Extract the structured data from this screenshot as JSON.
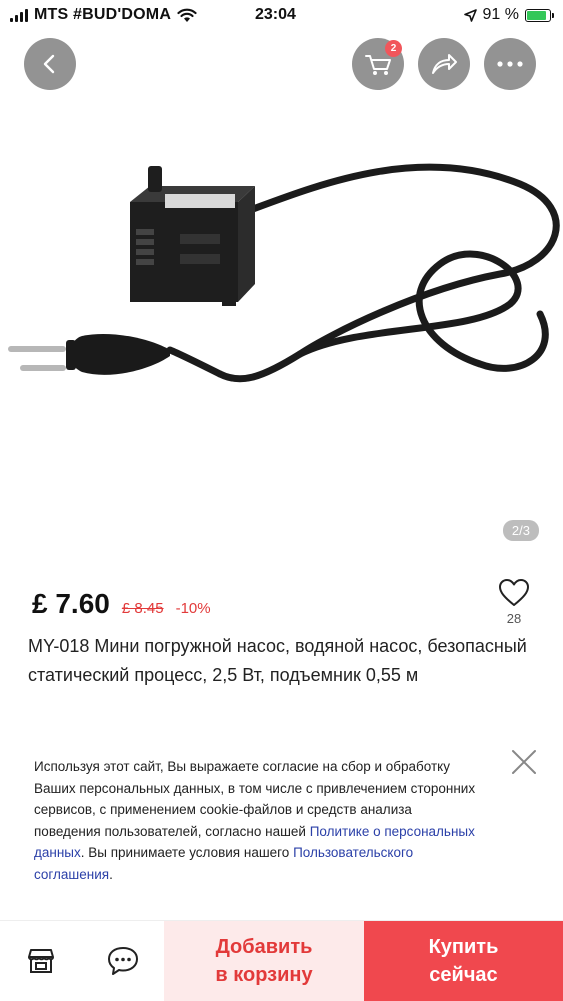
{
  "status_bar": {
    "carrier": "MTS #BUD'DOMA",
    "time": "23:04",
    "battery": "91 %",
    "battery_level": 0.91
  },
  "product": {
    "image_counter": "2/3",
    "cart_count": "2",
    "price": "£ 7.60",
    "old_price": "£ 8.45",
    "discount": "-10%",
    "wishlist_count": "28",
    "title": "MY-018 Мини погружной насос, водяной насос, безопасный статический процесс, 2,5 Вт, подъемник 0,55 м"
  },
  "cookie_notice": {
    "text_1": "Используя этот сайт, Вы выражаете согласие на сбор и обработку Ваших персональных данных, в том числе с привлечением сторонних сервисов, с применением cookie-файлов и средств анализа поведения пользователей, согласно нашей ",
    "privacy_link": "Политике о персональных данных",
    "text_2": ". Вы  принимаете условия нашего ",
    "terms_link": "Пользовательского соглашения",
    "text_3": "."
  },
  "bottom_bar": {
    "add_to_cart": "Добавить\nв корзину",
    "buy_now": "Купить\nсейчас"
  },
  "colors": {
    "accent": "#f0484e",
    "accent_light": "#fdeaea",
    "link": "#2b40a8",
    "battery_green": "#34c759"
  },
  "icons": [
    "back-icon",
    "cart-icon",
    "share-icon",
    "more-icon",
    "heart-icon",
    "close-icon",
    "store-icon",
    "chat-icon",
    "location-arrow-icon",
    "wifi-icon"
  ]
}
